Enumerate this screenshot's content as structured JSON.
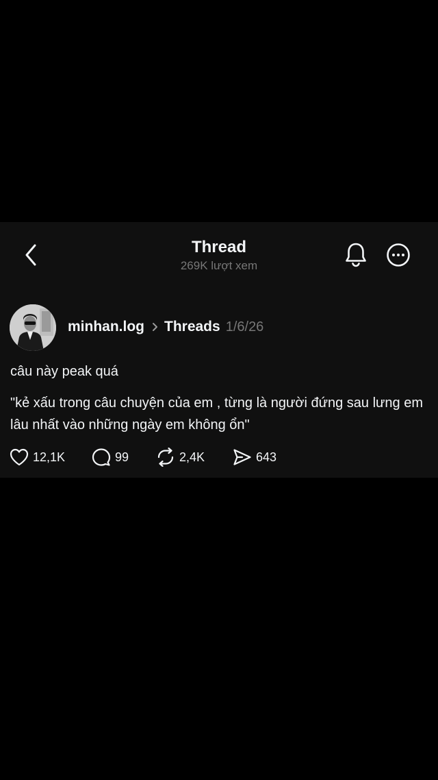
{
  "header": {
    "title": "Thread",
    "views": "269K lượt xem"
  },
  "post": {
    "username": "minhan.log",
    "community": "Threads",
    "date": "1/6/26",
    "text": "câu này peak quá",
    "quote": "\"kẻ xấu trong câu chuyện của em , từng là người đứng sau lưng em lâu nhất vào những ngày em không ổn\"",
    "actions": {
      "likes": "12,1K",
      "replies": "99",
      "reposts": "2,4K",
      "shares": "643"
    }
  },
  "icons": {
    "back": "chevron-left-icon",
    "notifications": "bell-icon",
    "more": "more-circle-icon",
    "breadcrumb": "chevron-right-icon",
    "like": "heart-icon",
    "reply": "comment-icon",
    "repost": "repost-icon",
    "share": "send-icon"
  },
  "colors": {
    "background": "#000000",
    "panel": "#101010",
    "text": "#f3f5f7",
    "secondary_text": "#777777"
  }
}
